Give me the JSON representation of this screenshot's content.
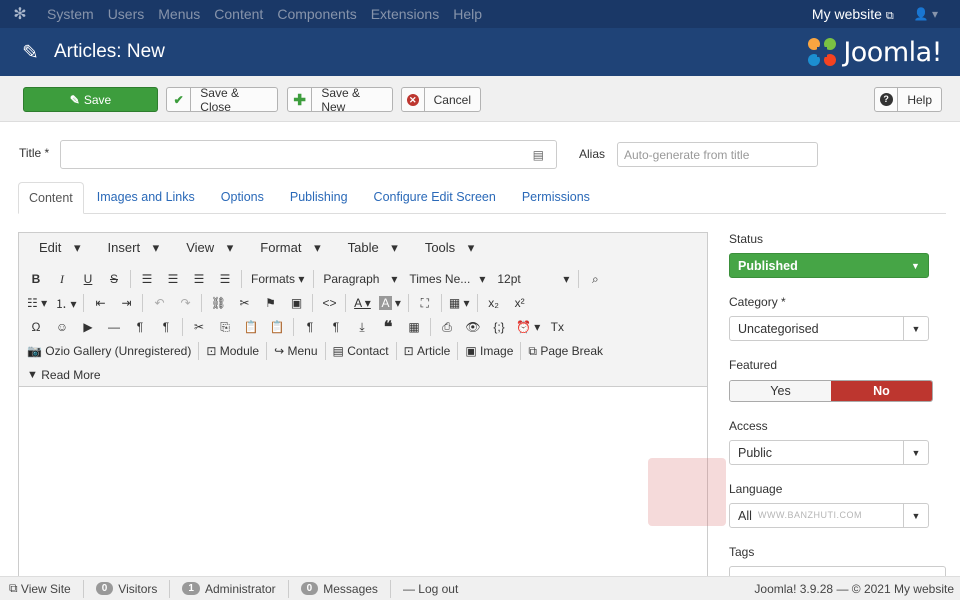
{
  "topbar": {
    "menu": [
      "System",
      "Users",
      "Menus",
      "Content",
      "Components",
      "Extensions",
      "Help"
    ],
    "site": "My website"
  },
  "header": {
    "title": "Articles: New",
    "brand": "Joomla!"
  },
  "toolbar": {
    "save": "Save",
    "save_close": "Save & Close",
    "save_new": "Save & New",
    "cancel": "Cancel",
    "help": "Help"
  },
  "form": {
    "title_label": "Title *",
    "title_value": "",
    "alias_label": "Alias",
    "alias_placeholder": "Auto-generate from title"
  },
  "tabs": [
    "Content",
    "Images and Links",
    "Options",
    "Publishing",
    "Configure Edit Screen",
    "Permissions"
  ],
  "editor": {
    "menus": [
      "Edit",
      "Insert",
      "View",
      "Format",
      "Table",
      "Tools"
    ],
    "formats": "Formats",
    "paragraph": "Paragraph",
    "font": "Times Ne...",
    "size": "12pt",
    "plugins": [
      "Ozio Gallery (Unregistered)",
      "Module",
      "Menu",
      "Contact",
      "Article",
      "Image",
      "Page Break"
    ],
    "readmore": "Read More"
  },
  "sidebar": {
    "status_label": "Status",
    "status_value": "Published",
    "category_label": "Category *",
    "category_value": "Uncategorised",
    "featured_label": "Featured",
    "featured_yes": "Yes",
    "featured_no": "No",
    "access_label": "Access",
    "access_value": "Public",
    "language_label": "Language",
    "language_value": "All",
    "tags_label": "Tags"
  },
  "watermark": {
    "text": "WWW.BANZHUTI.COM"
  },
  "statusbar": {
    "view_site": "View Site",
    "visitors_count": "0",
    "visitors": "Visitors",
    "admin_count": "1",
    "admin": "Administrator",
    "messages_count": "0",
    "messages": "Messages",
    "logout": "Log out",
    "version": "Joomla! 3.9.28 — © 2021 My website"
  },
  "colors": {
    "topbar": "#1a3867",
    "header": "#1f4377",
    "save": "#3d9d3d",
    "published": "#46a546",
    "no": "#bd362f"
  }
}
